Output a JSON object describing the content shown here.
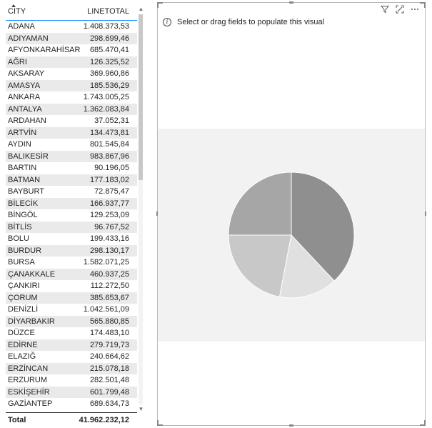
{
  "table": {
    "headers": {
      "city": "CITY",
      "total": "LINETOTAL"
    },
    "rows": [
      {
        "city": "ADANA",
        "total": "1.408.373,53"
      },
      {
        "city": "ADIYAMAN",
        "total": "298.699,46"
      },
      {
        "city": "AFYONKARAHİSAR",
        "total": "685.470,41"
      },
      {
        "city": "AĞRI",
        "total": "126.325,52"
      },
      {
        "city": "AKSARAY",
        "total": "369.960,86"
      },
      {
        "city": "AMASYA",
        "total": "185.536,29"
      },
      {
        "city": "ANKARA",
        "total": "1.743.005,25"
      },
      {
        "city": "ANTALYA",
        "total": "1.362.083,84"
      },
      {
        "city": "ARDAHAN",
        "total": "37.052,31"
      },
      {
        "city": "ARTVİN",
        "total": "134.473,81"
      },
      {
        "city": "AYDIN",
        "total": "801.545,84"
      },
      {
        "city": "BALIKESİR",
        "total": "983.867,96"
      },
      {
        "city": "BARTIN",
        "total": "90.196,05"
      },
      {
        "city": "BATMAN",
        "total": "177.183,02"
      },
      {
        "city": "BAYBURT",
        "total": "72.875,47"
      },
      {
        "city": "BİLECİK",
        "total": "166.937,77"
      },
      {
        "city": "BİNGÖL",
        "total": "129.253,09"
      },
      {
        "city": "BİTLİS",
        "total": "96.767,52"
      },
      {
        "city": "BOLU",
        "total": "199.433,16"
      },
      {
        "city": "BURDUR",
        "total": "298.130,17"
      },
      {
        "city": "BURSA",
        "total": "1.582.071,25"
      },
      {
        "city": "ÇANAKKALE",
        "total": "460.937,25"
      },
      {
        "city": "ÇANKIRI",
        "total": "112.272,50"
      },
      {
        "city": "ÇORUM",
        "total": "385.653,67"
      },
      {
        "city": "DENİZLİ",
        "total": "1.042.561,09"
      },
      {
        "city": "DİYARBAKIR",
        "total": "565.880,85"
      },
      {
        "city": "DÜZCE",
        "total": "174.483,10"
      },
      {
        "city": "EDİRNE",
        "total": "279.719,73"
      },
      {
        "city": "ELAZIĞ",
        "total": "240.664,62"
      },
      {
        "city": "ERZİNCAN",
        "total": "215.078,18"
      },
      {
        "city": "ERZURUM",
        "total": "282.501,48"
      },
      {
        "city": "ESKİŞEHİR",
        "total": "601.799,48"
      },
      {
        "city": "GAZİANTEP",
        "total": "689.634,73"
      }
    ],
    "footer": {
      "label": "Total",
      "total": "41.962.232,12"
    }
  },
  "pie_visual": {
    "info_text": "Select or drag fields to populate this visual",
    "icons": [
      "filter-icon",
      "focus-mode-icon",
      "more-options-icon"
    ]
  },
  "colors": {
    "accent": "#118dff",
    "slice_1": "#a6a6a6",
    "slice_2": "#c8c8c8",
    "slice_3": "#e0e0e0",
    "slice_4": "#8f8f8f",
    "placeholder_bg": "#f2f2f2"
  },
  "chart_data": {
    "type": "pie",
    "categories": [
      "",
      "",
      "",
      ""
    ],
    "values": [
      25,
      22,
      15,
      38
    ]
  }
}
